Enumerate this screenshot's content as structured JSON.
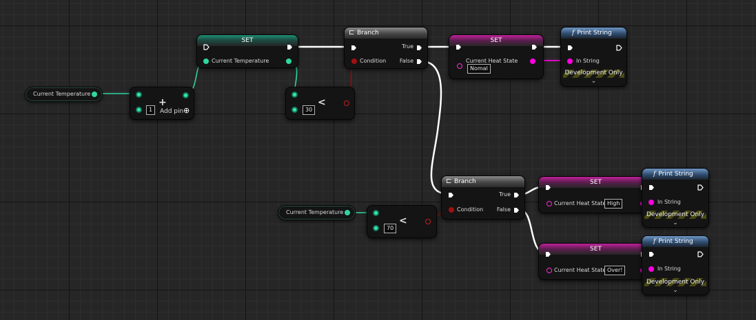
{
  "var_getters": {
    "current_temperature": "Current Temperature"
  },
  "set_temperature": {
    "title": "SET",
    "pin_label": "Current Temperature"
  },
  "add_node": {
    "symbol": "+",
    "input_value": "1",
    "add_pin_label": "Add pin",
    "add_pin_icon": "plus-circle-icon"
  },
  "less_node_a": {
    "operator": "<",
    "input_value": "30"
  },
  "less_node_b": {
    "operator": "<",
    "input_value": "70"
  },
  "branch_1": {
    "title": "Branch",
    "condition_label": "Condition",
    "true_label": "True",
    "false_label": "False"
  },
  "branch_2": {
    "title": "Branch",
    "condition_label": "Condition",
    "true_label": "True",
    "false_label": "False"
  },
  "set_heat_normal": {
    "title": "SET",
    "pin_label": "Current Heat State",
    "value": "Nomal"
  },
  "set_heat_high": {
    "title": "SET",
    "pin_label": "Current Heat State",
    "value": "High"
  },
  "set_heat_over": {
    "title": "SET",
    "pin_label": "Current Heat State",
    "value": "Over!"
  },
  "print_1": {
    "title": "Print String",
    "function_tag": "f",
    "in_string_label": "In String",
    "dev_label": "Development Only",
    "expand_icon": "chevron-down-icon"
  },
  "print_2": {
    "title": "Print String",
    "function_tag": "f",
    "in_string_label": "In String",
    "dev_label": "Development Only",
    "expand_icon": "chevron-down-icon"
  },
  "print_3": {
    "title": "Print String",
    "function_tag": "f",
    "in_string_label": "In String",
    "dev_label": "Development Only",
    "expand_icon": "chevron-down-icon"
  },
  "colors": {
    "graph_bg": "#262626",
    "float_pin": "#2fd6a2",
    "bool_pin": "#a01010",
    "string_pin": "#ff00e0",
    "exec_wire": "#ffffff"
  }
}
